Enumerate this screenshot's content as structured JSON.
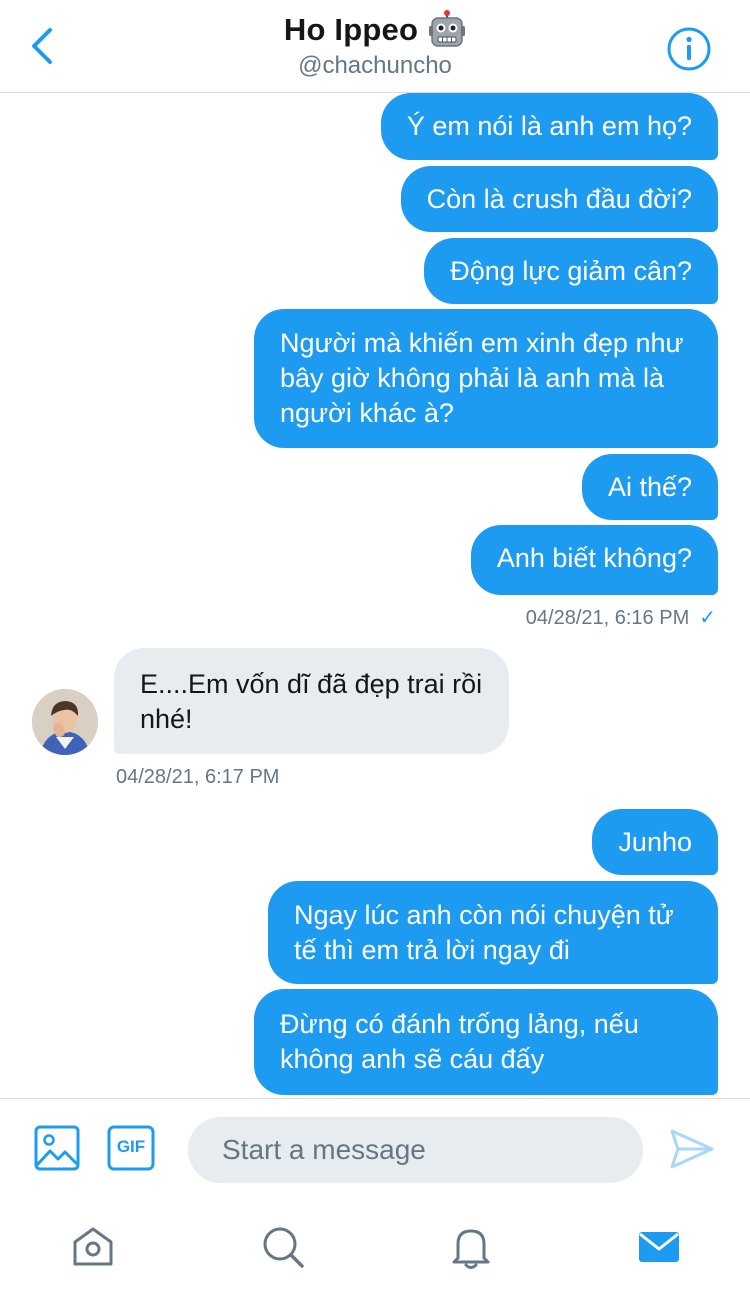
{
  "header": {
    "title": "Ho Ippeo",
    "handle": "@chachuncho"
  },
  "messages": [
    {
      "id": 1,
      "direction": "outgoing",
      "text": "Ý em nói là anh em họ?"
    },
    {
      "id": 2,
      "direction": "outgoing",
      "text": "Còn là crush đầu đời?"
    },
    {
      "id": 3,
      "direction": "outgoing",
      "text": "Động lực giảm cân?"
    },
    {
      "id": 4,
      "direction": "outgoing",
      "text": "Người mà khiến em xinh đẹp như bây giờ không phải là anh mà là người khác à?"
    },
    {
      "id": 5,
      "direction": "outgoing",
      "text": "Ai thế?"
    },
    {
      "id": 6,
      "direction": "outgoing",
      "text": "Anh biết không?"
    },
    {
      "id": 7,
      "direction": "incoming",
      "text": "E....Em vốn dĩ đã đẹp trai rồi nhé!"
    },
    {
      "id": 8,
      "direction": "outgoing",
      "text": "Junho"
    },
    {
      "id": 9,
      "direction": "outgoing",
      "text": "Ngay lúc anh còn nói chuyện tử tế thì em trả lời ngay đi"
    },
    {
      "id": 10,
      "direction": "outgoing",
      "text": "Đừng có đánh trống lảng, nếu không anh sẽ cáu đấy"
    }
  ],
  "timestamps": {
    "outgoing_group": "04/28/21, 6:16 PM",
    "outgoing_check": "✓",
    "incoming_group": "04/28/21, 6:17 PM"
  },
  "composer": {
    "placeholder": "Start a message",
    "gif_label": "GIF"
  },
  "icons": {
    "back": "chevron-left-icon",
    "info": "info-icon",
    "title_emoji": "robot-icon",
    "image": "image-icon",
    "gif": "gif-icon",
    "send": "send-icon",
    "home": "home-icon",
    "search": "search-icon",
    "notifications": "bell-icon",
    "messages": "mail-icon"
  },
  "colors": {
    "accent": "#1d9bf0",
    "incoming_bubble": "#e6ecf0",
    "secondary_text": "#657786"
  }
}
